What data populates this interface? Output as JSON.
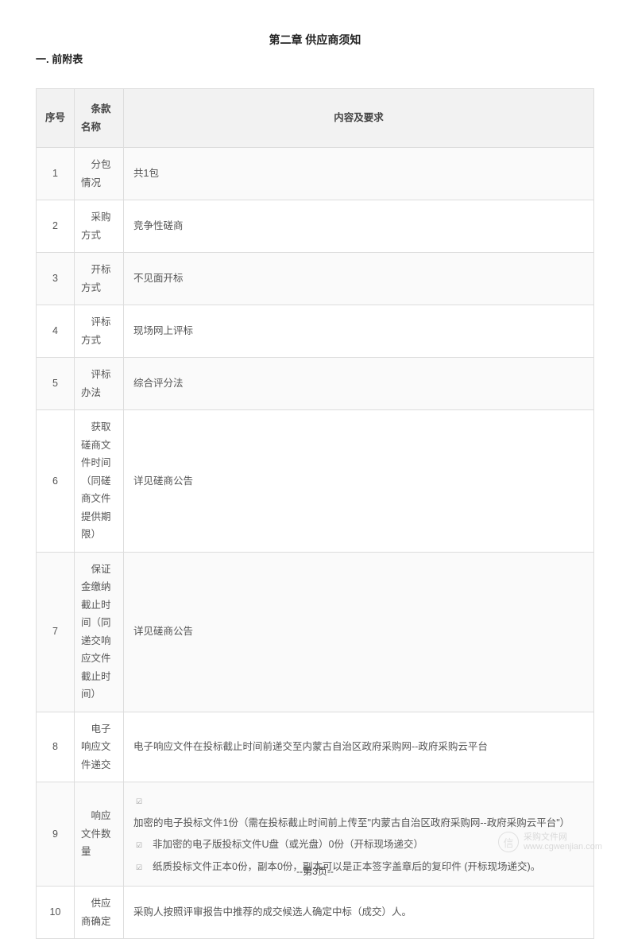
{
  "chapter_title": "第二章 供应商须知",
  "section_title": "一. 前附表",
  "headers": {
    "seq": "序号",
    "name": "条款名称",
    "content": "内容及要求"
  },
  "rows": [
    {
      "seq": "1",
      "name": "分包情况",
      "content": "共1包",
      "shaded": true
    },
    {
      "seq": "2",
      "name": "采购方式",
      "content": "竞争性磋商",
      "shaded": false
    },
    {
      "seq": "3",
      "name": "开标方式",
      "content": "不见面开标",
      "shaded": true
    },
    {
      "seq": "4",
      "name": "评标方式",
      "content": "现场网上评标",
      "shaded": false
    },
    {
      "seq": "5",
      "name": "评标办法",
      "content": "综合评分法",
      "shaded": true
    },
    {
      "seq": "6",
      "name": "获取磋商文件时间（同磋商文件提供期限）",
      "content": "详见磋商公告",
      "shaded": false
    },
    {
      "seq": "7",
      "name": "保证金缴纳截止时间（同递交响应文件截止时间）",
      "content": "详见磋商公告",
      "shaded": true
    },
    {
      "seq": "8",
      "name": "电子响应文件递交",
      "content": "电子响应文件在投标截止时间前递交至内蒙古自治区政府采购网--政府采购云平台",
      "shaded": false
    },
    {
      "seq": "9",
      "name": "响应文件数量",
      "content_list": [
        "加密的电子投标文件1份（需在投标截止时间前上传至\"内蒙古自治区政府采购网--政府采购云平台\"）",
        "非加密的电子版投标文件U盘（或光盘）0份（开标现场递交）",
        "纸质投标文件正本0份，副本0份，副本可以是正本签字盖章后的复印件 (开标现场递交)。"
      ],
      "shaded": true
    },
    {
      "seq": "10",
      "name": "供应商确定",
      "content": "采购人按照评审报告中推荐的成交候选人确定中标（成交）人。",
      "shaded": false
    }
  ],
  "footer": "--第3页--",
  "watermark": {
    "icon": "信",
    "line1": "采购文件网",
    "line2": "www.cgwenjian.com"
  }
}
